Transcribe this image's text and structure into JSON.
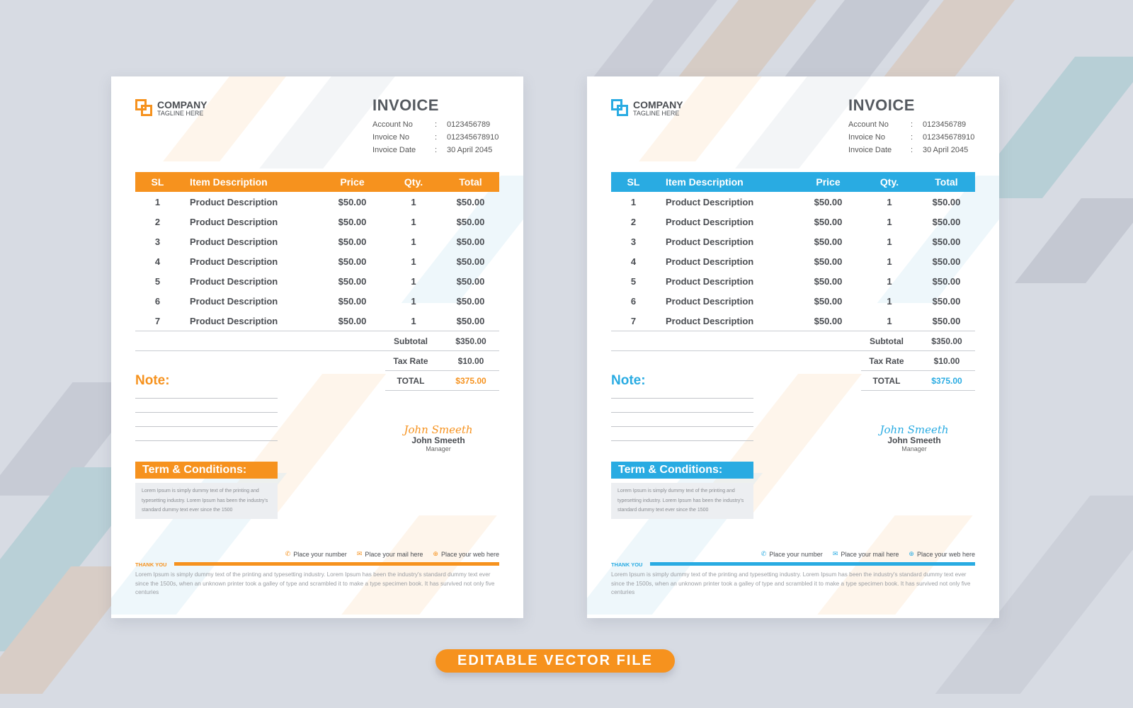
{
  "theme": {
    "orange": "#f6921e",
    "blue": "#29abe2",
    "background": "#d7dbe3",
    "text": "#4a4d52"
  },
  "invoices": [
    {
      "variant": "orange",
      "accent": "#f6921e",
      "company": {
        "name": "COMPANY",
        "tagline": "TAGLINE HERE",
        "logo_icon": "overlapping-squares-icon"
      },
      "title": "INVOICE",
      "meta": [
        {
          "label": "Account No",
          "sep": ":",
          "value": "0123456789"
        },
        {
          "label": "Invoice No",
          "sep": ":",
          "value": "012345678910"
        },
        {
          "label": "Invoice Date",
          "sep": ":",
          "value": "30 April 2045"
        }
      ],
      "table": {
        "headers": [
          "SL",
          "Item Description",
          "Price",
          "Qty.",
          "Total"
        ],
        "rows": [
          [
            "1",
            "Product Description",
            "$50.00",
            "1",
            "$50.00"
          ],
          [
            "2",
            "Product Description",
            "$50.00",
            "1",
            "$50.00"
          ],
          [
            "3",
            "Product Description",
            "$50.00",
            "1",
            "$50.00"
          ],
          [
            "4",
            "Product Description",
            "$50.00",
            "1",
            "$50.00"
          ],
          [
            "5",
            "Product Description",
            "$50.00",
            "1",
            "$50.00"
          ],
          [
            "6",
            "Product Description",
            "$50.00",
            "1",
            "$50.00"
          ],
          [
            "7",
            "Product Description",
            "$50.00",
            "1",
            "$50.00"
          ]
        ]
      },
      "summary": {
        "subtotal_label": "Subtotal",
        "subtotal": "$350.00",
        "tax_label": "Tax Rate",
        "tax": "$10.00",
        "total_label": "TOTAL",
        "total": "$375.00"
      },
      "note_label": "Note:",
      "signature": {
        "script": "John Smeeth",
        "name": "John Smeeth",
        "role": "Manager"
      },
      "terms": {
        "heading": "Term & Conditions:",
        "body": "Lorem Ipsum is simply dummy text of the printing and typesetting industry. Lorem Ipsum has been the industry's standard dummy text ever since the 1500"
      },
      "contacts": [
        {
          "icon": "phone-icon",
          "glyph": "✆",
          "text": "Place your number"
        },
        {
          "icon": "mail-icon",
          "glyph": "✉",
          "text": "Place your mail here"
        },
        {
          "icon": "globe-icon",
          "glyph": "⊕",
          "text": "Place your web here"
        }
      ],
      "thank_you": "THANK YOU",
      "footer_text": "Lorem Ipsum is simply dummy text of the printing and typesetting industry. Lorem Ipsum has been the industry's standard dummy text ever since the 1500s, when an unknown printer took a galley of type and scrambled it to make a type specimen book. It has survived not only five centuries"
    },
    {
      "variant": "blue",
      "accent": "#29abe2",
      "company": {
        "name": "COMPANY",
        "tagline": "TAGLINE HERE",
        "logo_icon": "overlapping-squares-icon"
      },
      "title": "INVOICE",
      "meta": [
        {
          "label": "Account No",
          "sep": ":",
          "value": "0123456789"
        },
        {
          "label": "Invoice No",
          "sep": ":",
          "value": "012345678910"
        },
        {
          "label": "Invoice Date",
          "sep": ":",
          "value": "30 April 2045"
        }
      ],
      "table": {
        "headers": [
          "SL",
          "Item Description",
          "Price",
          "Qty.",
          "Total"
        ],
        "rows": [
          [
            "1",
            "Product Description",
            "$50.00",
            "1",
            "$50.00"
          ],
          [
            "2",
            "Product Description",
            "$50.00",
            "1",
            "$50.00"
          ],
          [
            "3",
            "Product Description",
            "$50.00",
            "1",
            "$50.00"
          ],
          [
            "4",
            "Product Description",
            "$50.00",
            "1",
            "$50.00"
          ],
          [
            "5",
            "Product Description",
            "$50.00",
            "1",
            "$50.00"
          ],
          [
            "6",
            "Product Description",
            "$50.00",
            "1",
            "$50.00"
          ],
          [
            "7",
            "Product Description",
            "$50.00",
            "1",
            "$50.00"
          ]
        ]
      },
      "summary": {
        "subtotal_label": "Subtotal",
        "subtotal": "$350.00",
        "tax_label": "Tax Rate",
        "tax": "$10.00",
        "total_label": "TOTAL",
        "total": "$375.00"
      },
      "note_label": "Note:",
      "signature": {
        "script": "John Smeeth",
        "name": "John Smeeth",
        "role": "Manager"
      },
      "terms": {
        "heading": "Term & Conditions:",
        "body": "Lorem Ipsum is simply dummy text of the printing and typesetting industry. Lorem Ipsum has been the industry's standard dummy text ever since the 1500"
      },
      "contacts": [
        {
          "icon": "phone-icon",
          "glyph": "✆",
          "text": "Place your number"
        },
        {
          "icon": "mail-icon",
          "glyph": "✉",
          "text": "Place your mail here"
        },
        {
          "icon": "globe-icon",
          "glyph": "⊕",
          "text": "Place your web here"
        }
      ],
      "thank_you": "THANK YOU",
      "footer_text": "Lorem Ipsum is simply dummy text of the printing and typesetting industry. Lorem Ipsum has been the industry's standard dummy text ever since the 1500s, when an unknown printer took a galley of type and scrambled it to make a type specimen book. It has survived not only five centuries"
    }
  ],
  "badge": {
    "label": "EDITABLE VECTOR  FILE"
  }
}
